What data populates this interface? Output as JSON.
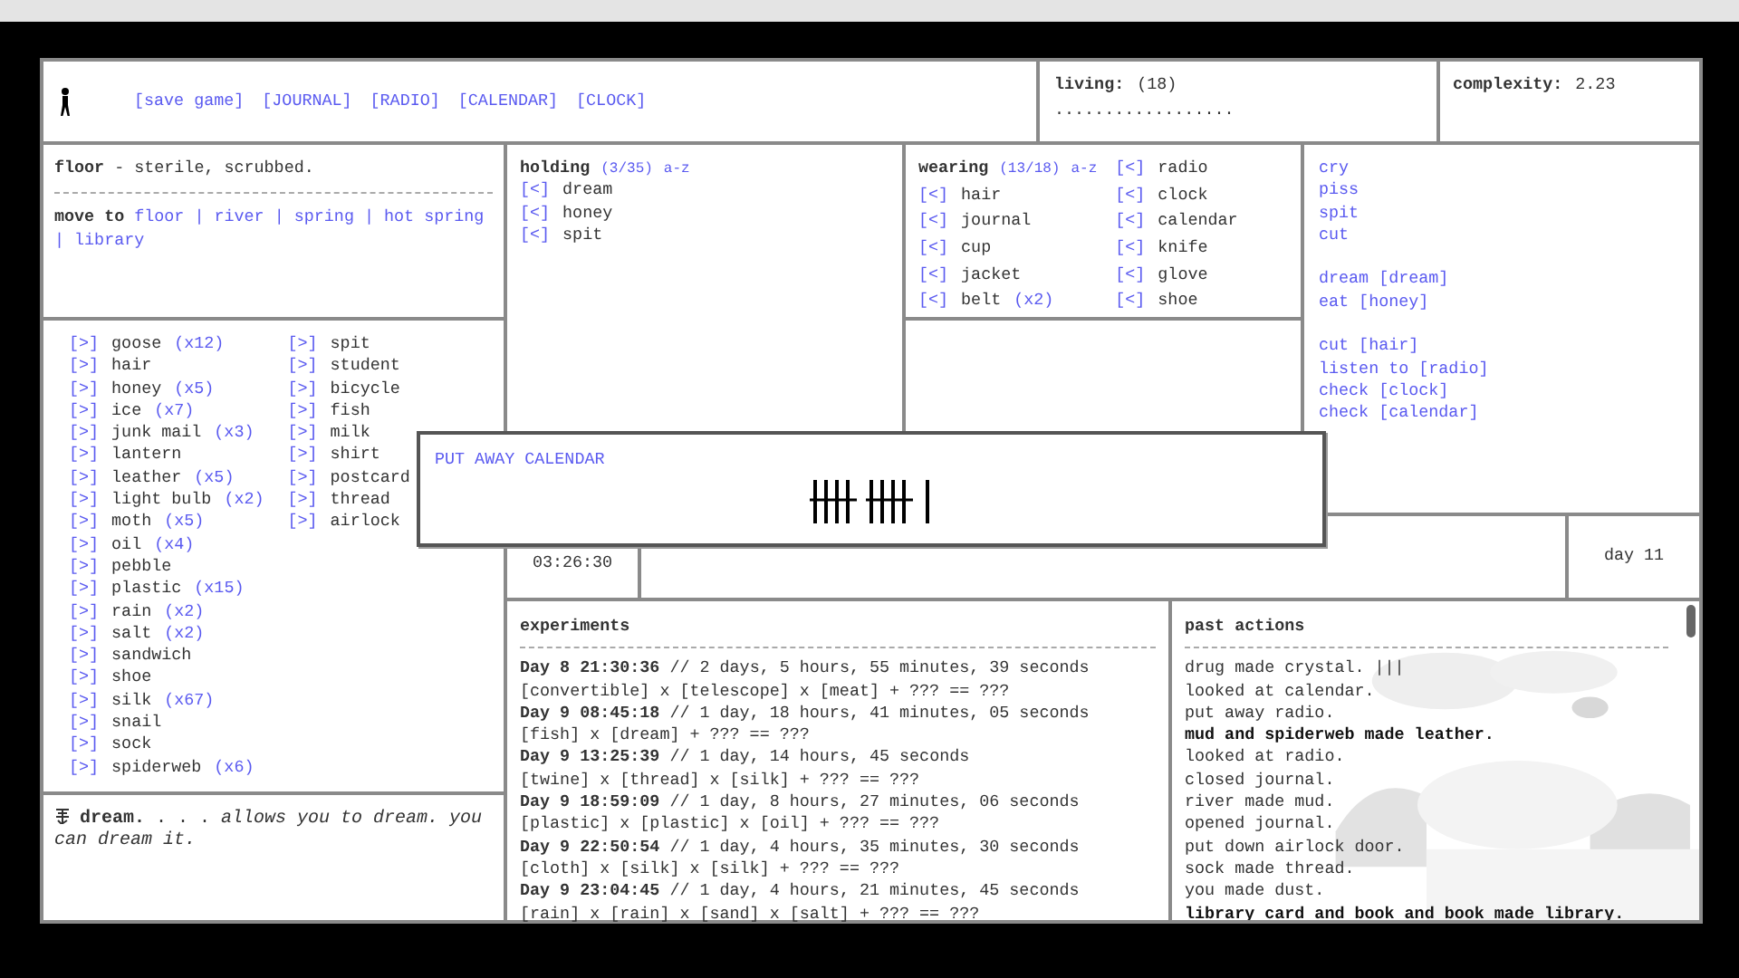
{
  "nav": {
    "links": [
      "[save game]",
      "[JOURNAL]",
      "[RADIO]",
      "[CALENDAR]",
      "[CLOCK]"
    ]
  },
  "living": {
    "label": "living:",
    "count": "(18)",
    "dots": ".................."
  },
  "complexity": {
    "label": "complexity:",
    "value": "2.23"
  },
  "location": {
    "description": "**floor** - sterile, scrubbed.",
    "move_label": "move to",
    "destinations": [
      "floor",
      "river",
      "spring",
      "hot spring",
      "library"
    ],
    "separator": "|"
  },
  "holding": {
    "title": "holding",
    "count": "(3/35)",
    "sort": "a-z",
    "items": [
      {
        "button": "[<]",
        "name": "dream"
      },
      {
        "button": "[<]",
        "name": "honey"
      },
      {
        "button": "[<]",
        "name": "spit"
      }
    ]
  },
  "wearing": {
    "title": "wearing",
    "count": "(13/18)",
    "sort": "a-z",
    "items": [
      {
        "button": "[<]",
        "name": "hair"
      },
      {
        "button": "[<]",
        "name": "journal"
      },
      {
        "button": "[<]",
        "name": "cup"
      },
      {
        "button": "[<]",
        "name": "jacket"
      },
      {
        "button": "[<]",
        "name": "belt",
        "qty": "(x2)"
      },
      {
        "button": "[<]",
        "name": "radio"
      },
      {
        "button": "[<]",
        "name": "clock"
      },
      {
        "button": "[<]",
        "name": "calendar"
      },
      {
        "button": "[<]",
        "name": "knife"
      },
      {
        "button": "[<]",
        "name": "glove"
      },
      {
        "button": "[<]",
        "name": "shoe"
      }
    ]
  },
  "actions": {
    "groups": [
      [
        "cry",
        "piss",
        "spit",
        "cut"
      ],
      [
        "dream [dream]",
        "eat [honey]"
      ],
      [
        "cut [hair]",
        "listen to [radio]",
        "check [clock]",
        "check [calendar]"
      ]
    ]
  },
  "inventory": {
    "columns": [
      [
        {
          "button": "[>]",
          "name": "goose",
          "qty": "(x12)"
        },
        {
          "button": "[>]",
          "name": "hair"
        },
        {
          "button": "[>]",
          "name": "honey",
          "qty": "(x5)"
        },
        {
          "button": "[>]",
          "name": "ice",
          "qty": "(x7)"
        },
        {
          "button": "[>]",
          "name": "junk mail",
          "qty": "(x3)"
        },
        {
          "button": "[>]",
          "name": "lantern"
        },
        {
          "button": "[>]",
          "name": "leather",
          "qty": "(x5)"
        },
        {
          "button": "[>]",
          "name": "light bulb",
          "qty": "(x2)"
        },
        {
          "button": "[>]",
          "name": "moth",
          "qty": "(x5)"
        },
        {
          "button": "[>]",
          "name": "oil",
          "qty": "(x4)"
        },
        {
          "button": "[>]",
          "name": "pebble"
        },
        {
          "button": "[>]",
          "name": "plastic",
          "qty": "(x15)"
        },
        {
          "button": "[>]",
          "name": "rain",
          "qty": "(x2)"
        },
        {
          "button": "[>]",
          "name": "salt",
          "qty": "(x2)"
        },
        {
          "button": "[>]",
          "name": "sandwich"
        },
        {
          "button": "[>]",
          "name": "shoe"
        },
        {
          "button": "[>]",
          "name": "silk",
          "qty": "(x67)"
        },
        {
          "button": "[>]",
          "name": "snail"
        },
        {
          "button": "[>]",
          "name": "sock"
        },
        {
          "button": "[>]",
          "name": "spiderweb",
          "qty": "(x6)"
        }
      ],
      [
        {
          "button": "[>]",
          "name": "spit"
        },
        {
          "button": "[>]",
          "name": "student"
        },
        {
          "button": "[>]",
          "name": "bicycle"
        },
        {
          "button": "[>]",
          "name": "fish"
        },
        {
          "button": "[>]",
          "name": "milk"
        },
        {
          "button": "[>]",
          "name": "shirt"
        },
        {
          "button": "[>]",
          "name": "postcard"
        },
        {
          "button": "[>]",
          "name": "thread"
        },
        {
          "button": "[>]",
          "name": "airlock"
        }
      ]
    ]
  },
  "description": {
    "text": "**dream.** . . . *allows you to dream. you can dream it.*"
  },
  "clock": {
    "time": "03:26:30"
  },
  "day": {
    "label": "day 11"
  },
  "popup": {
    "action": "PUT AWAY CALENDAR"
  },
  "experiments": {
    "title": "experiments",
    "entries": [
      {
        "time": "**Day 8 21:30:36** // 2 days, 5 hours, 55 minutes, 39 seconds",
        "recipe": "[convertible] x [telescope] x [meat] + ??? == ???"
      },
      {
        "time": "**Day 9 08:45:18** // 1 day, 18 hours, 41 minutes, 05 seconds",
        "recipe": "[fish] x [dream] + ??? == ???"
      },
      {
        "time": "**Day 9 13:25:39** // 1 day, 14 hours, 45 seconds",
        "recipe": "[twine] x [thread] x [silk] + ??? == ???"
      },
      {
        "time": "**Day 9 18:59:09** // 1 day, 8 hours, 27 minutes, 06 seconds",
        "recipe": "[plastic] x [plastic] x [oil] + ??? == ???"
      },
      {
        "time": "**Day 9 22:50:54** // 1 day, 4 hours, 35 minutes, 30 seconds",
        "recipe": "[cloth] x [silk] x [silk] + ??? == ???"
      },
      {
        "time": "**Day 9 23:04:45** // 1 day, 4 hours, 21 minutes, 45 seconds",
        "recipe": "[rain] x [rain] x [sand] x [salt] + ??? == ???"
      }
    ]
  },
  "past_actions": {
    "title": "past actions",
    "entries": [
      {
        "text": "drug made crystal. |||",
        "bold": false
      },
      {
        "text": "looked at calendar.",
        "bold": false
      },
      {
        "text": "put away radio.",
        "bold": false
      },
      {
        "text": "mud and spiderweb made leather.",
        "bold": true
      },
      {
        "text": "looked at radio.",
        "bold": false
      },
      {
        "text": "closed journal.",
        "bold": false
      },
      {
        "text": "river made mud.",
        "bold": false
      },
      {
        "text": "opened journal.",
        "bold": false
      },
      {
        "text": "put down airlock door.",
        "bold": false
      },
      {
        "text": "sock made thread.",
        "bold": false
      },
      {
        "text": "you made dust.",
        "bold": false
      },
      {
        "text": "library card and book and book made library.",
        "bold": true
      }
    ]
  }
}
